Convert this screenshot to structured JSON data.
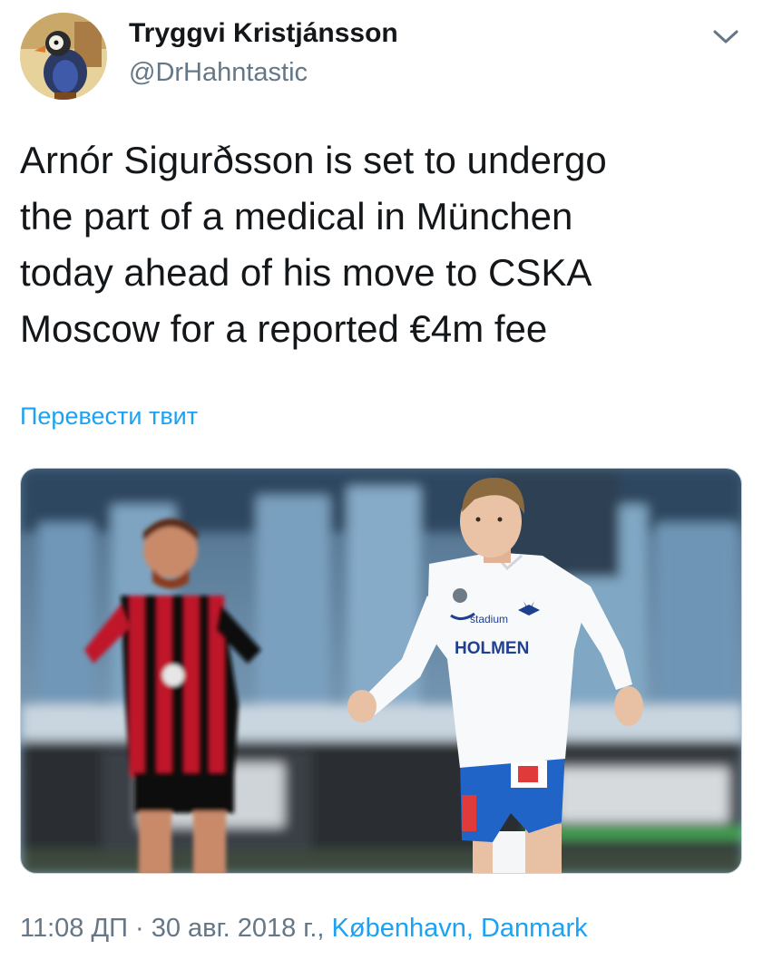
{
  "tweet": {
    "author": {
      "display_name": "Tryggvi Kristjánsson",
      "handle": "@DrHahntastic"
    },
    "menu_icon": "chevron-down-icon",
    "text": "Arnór Sigurðsson is set to undergo\nthe part of a medical in München\ntoday ahead of his move to CSKA\nMoscow for a reported €4m fee",
    "translate_link": "Перевести твит",
    "media": {
      "jersey_sponsor": "HOLMEN",
      "jersey_text": "stadium"
    },
    "meta": {
      "timestamp": "11:08 ДП · 30 авг. 2018 г., ",
      "location": "København, Danmark"
    }
  },
  "colors": {
    "link": "#1da1f2",
    "secondary_text": "#657786",
    "primary_text": "#14171a"
  }
}
